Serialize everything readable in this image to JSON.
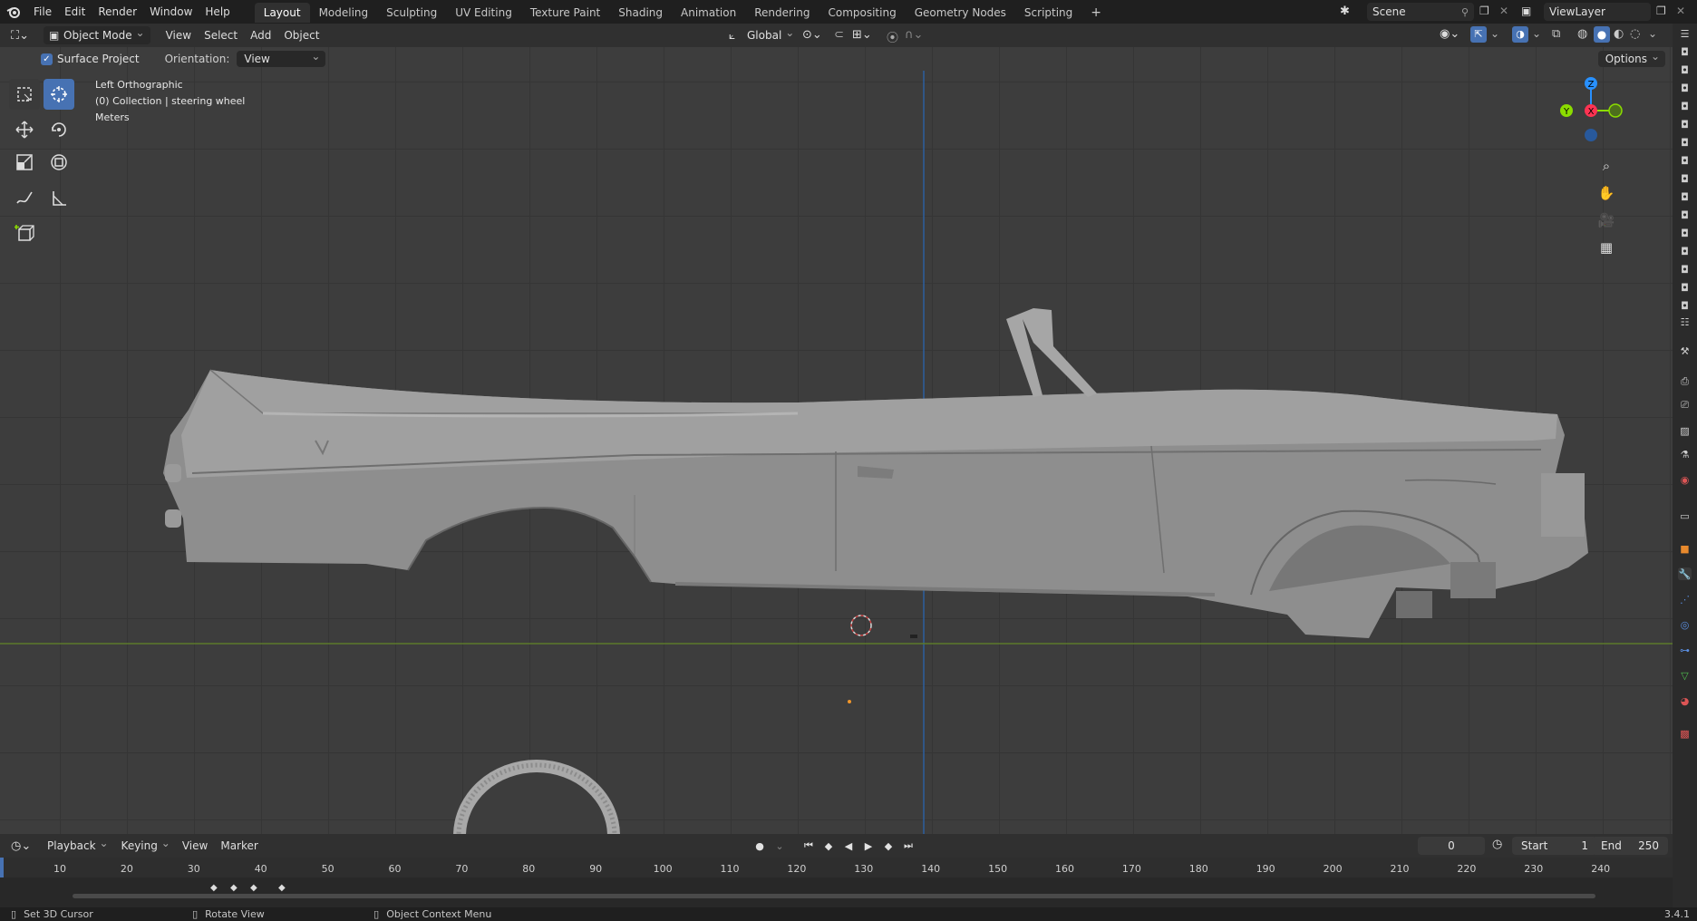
{
  "top_menu": {
    "items": [
      "File",
      "Edit",
      "Render",
      "Window",
      "Help"
    ]
  },
  "workspaces": {
    "tabs": [
      "Layout",
      "Modeling",
      "Sculpting",
      "UV Editing",
      "Texture Paint",
      "Shading",
      "Animation",
      "Rendering",
      "Compositing",
      "Geometry Nodes",
      "Scripting"
    ],
    "active": "Layout",
    "add_label": "+"
  },
  "scene": {
    "name": "Scene"
  },
  "view_layer": {
    "name": "ViewLayer"
  },
  "header": {
    "mode": "Object Mode",
    "menus": [
      "View",
      "Select",
      "Add",
      "Object"
    ],
    "transform_orientation": "Global"
  },
  "tool_settings": {
    "surface_project_label": "Surface Project",
    "orientation_label": "Orientation:",
    "orientation_value": "View",
    "options_label": "Options"
  },
  "viewport_info": {
    "view_name": "Left Orthographic",
    "collection": "(0) Collection | steering wheel",
    "units": "Meters"
  },
  "gizmo": {
    "z": "Z",
    "y": "Y",
    "x": "X"
  },
  "timeline": {
    "menus": [
      "Playback",
      "Keying",
      "View",
      "Marker"
    ],
    "current_frame": "0",
    "start_label": "Start",
    "start_value": "1",
    "end_label": "End",
    "end_value": "250",
    "ticks": [
      "10",
      "20",
      "30",
      "40",
      "50",
      "60",
      "70",
      "80",
      "90",
      "100",
      "110",
      "120",
      "130",
      "140",
      "150",
      "160",
      "170",
      "180",
      "190",
      "200",
      "210",
      "220",
      "230",
      "240"
    ]
  },
  "statusbar": {
    "hint1": "Set 3D Cursor",
    "hint2": "Rotate View",
    "hint3": "Object Context Menu",
    "version": "3.4.1"
  },
  "colors": {
    "accent": "#4772b3",
    "x_axis": "#ff3352",
    "y_axis": "#8bdc00",
    "z_axis": "#2890ff"
  }
}
